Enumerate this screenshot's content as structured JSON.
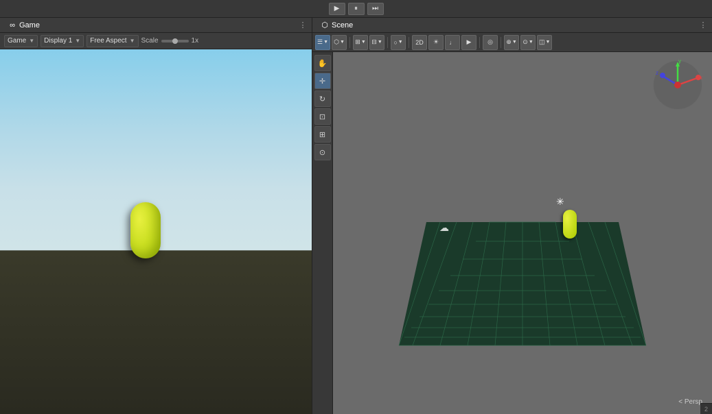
{
  "topbar": {
    "play_label": "▶",
    "pause_label": "⏸",
    "step_label": "⏭"
  },
  "game_panel": {
    "tab_label": "Game",
    "tab_icon": "∞",
    "more_icon": "⋮",
    "toolbar": {
      "display_label": "Game",
      "display_arrow": "▼",
      "display1_label": "Display 1",
      "display1_arrow": "▼",
      "aspect_label": "Free Aspect",
      "aspect_arrow": "▼",
      "scale_label": "Scale",
      "scale_value": "1x"
    }
  },
  "scene_panel": {
    "tab_label": "Scene",
    "tab_icon": "⬡",
    "more_icon": "⋮",
    "toolbar": {
      "btn_shading": "☰",
      "btn_overlay": "⬡",
      "btn_transform": "⊞",
      "btn_snap": "⊟",
      "btn_grid": "⊞",
      "btn_vis": "●",
      "btn_2d": "2D",
      "btn_light": "☀",
      "btn_audio": "♪",
      "btn_anim": "▶",
      "btn_gizmo": "◎",
      "btn_extra": "⊕",
      "btn_scene": "⊙",
      "btn_layers": "◫",
      "btn_more": "⋯"
    },
    "left_tools": {
      "tool_hand": "✋",
      "tool_move": "✛",
      "tool_rotate": "↻",
      "tool_scale": "⊡",
      "tool_rect": "⊞",
      "tool_transform": "⊙"
    },
    "persp_label": "< Persp"
  },
  "status": {
    "text": "2"
  }
}
